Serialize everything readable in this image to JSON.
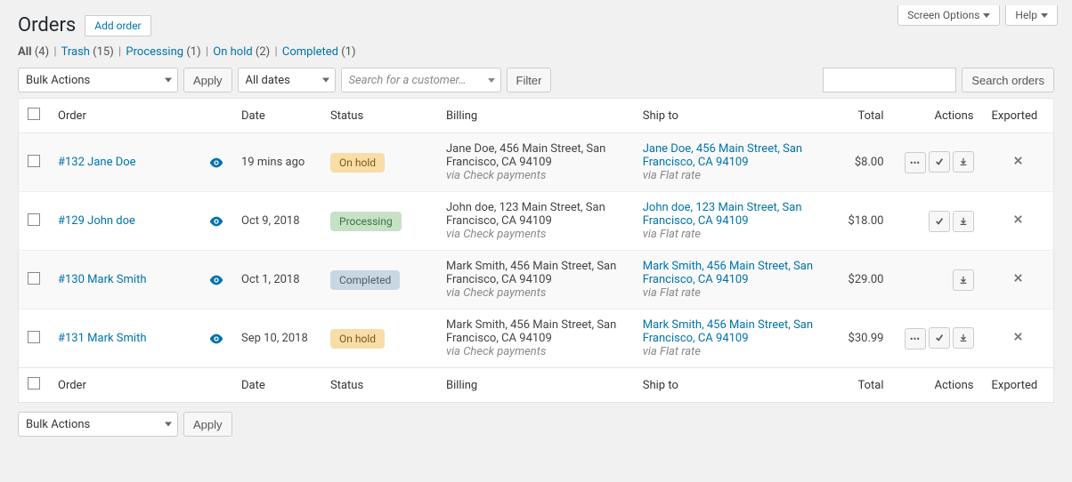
{
  "top": {
    "screen_options": "Screen Options",
    "help": "Help"
  },
  "page": {
    "title": "Orders",
    "add_order": "Add order"
  },
  "filters": {
    "all_label": "All",
    "all_count": "(4)",
    "trash_label": "Trash",
    "trash_count": "(15)",
    "processing_label": "Processing",
    "processing_count": "(1)",
    "onhold_label": "On hold",
    "onhold_count": "(2)",
    "completed_label": "Completed",
    "completed_count": "(1)",
    "separator": "|"
  },
  "toolbar": {
    "bulk_actions": "Bulk Actions",
    "apply": "Apply",
    "all_dates": "All dates",
    "customer_placeholder": "Search for a customer…",
    "filter": "Filter",
    "search_orders": "Search orders"
  },
  "columns": {
    "order": "Order",
    "date": "Date",
    "status": "Status",
    "billing": "Billing",
    "ship_to": "Ship to",
    "total": "Total",
    "actions": "Actions",
    "exported": "Exported"
  },
  "rows": [
    {
      "order": "#132 Jane Doe",
      "date": "19 mins ago",
      "status_class": "st-onhold",
      "status_text": "On hold",
      "billing_line": "Jane Doe, 456 Main Street, San Francisco, CA 94109",
      "billing_via": "via Check payments",
      "ship_link": "Jane Doe, 456 Main Street, San Francisco, CA 94109",
      "ship_via": "via Flat rate",
      "total": "$8.00",
      "show_more": true,
      "show_check": true,
      "show_download": true
    },
    {
      "order": "#129 John doe",
      "date": "Oct 9, 2018",
      "status_class": "st-processing",
      "status_text": "Processing",
      "billing_line": "John doe, 123 Main Street, San Francisco, CA 94109",
      "billing_via": "via Check payments",
      "ship_link": "John doe, 123 Main Street, San Francisco, CA 94109",
      "ship_via": "via Flat rate",
      "total": "$18.00",
      "show_more": false,
      "show_check": true,
      "show_download": true
    },
    {
      "order": "#130 Mark Smith",
      "date": "Oct 1, 2018",
      "status_class": "st-completed",
      "status_text": "Completed",
      "billing_line": "Mark Smith, 456 Main Street, San Francisco, CA 94109",
      "billing_via": "via Check payments",
      "ship_link": "Mark Smith, 456 Main Street, San Francisco, CA 94109",
      "ship_via": "via Flat rate",
      "total": "$29.00",
      "show_more": false,
      "show_check": false,
      "show_download": true
    },
    {
      "order": "#131 Mark Smith",
      "date": "Sep 10, 2018",
      "status_class": "st-onhold",
      "status_text": "On hold",
      "billing_line": "Mark Smith, 456 Main Street, San Francisco, CA 94109",
      "billing_via": "via Check payments",
      "ship_link": "Mark Smith, 456 Main Street, San Francisco, CA 94109",
      "ship_via": "via Flat rate",
      "total": "$30.99",
      "show_more": true,
      "show_check": true,
      "show_download": true
    }
  ]
}
